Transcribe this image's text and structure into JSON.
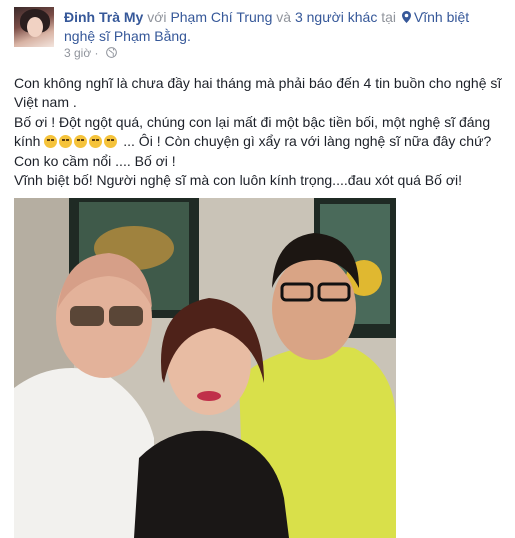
{
  "post": {
    "author": "Đinh Trà My",
    "with_text": "với",
    "tagged_person": "Phạm Chí Trung",
    "and_text": "và",
    "others": "3 người khác",
    "at_text": "tại",
    "location": "Vĩnh biệt nghệ sĩ Phạm Bằng.",
    "time": "3 giờ",
    "privacy_icon": "globe-icon",
    "text": {
      "line1": "Con không nghĩ là chưa đầy hai tháng mà phải báo đến 4 tin buồn cho nghệ sĩ Việt nam .",
      "line2_before": "Bố ơi ! Đột ngột quá, chúng con lại mất đi một bậc tiền bối, một nghệ sĩ đáng kính",
      "line2_after": " ... Ôi ! Còn chuyện gì xẩy ra với làng nghệ sĩ nữa đây chứ?Con ko cầm nổi .... Bố ơi !",
      "line3": "Vĩnh biệt bố! Người nghệ sĩ mà con luôn kính trọng....đau xót quá Bố ơi!"
    },
    "emoji_count": 5
  },
  "colors": {
    "link": "#365899",
    "meta": "#90949c",
    "text": "#1d2129"
  }
}
